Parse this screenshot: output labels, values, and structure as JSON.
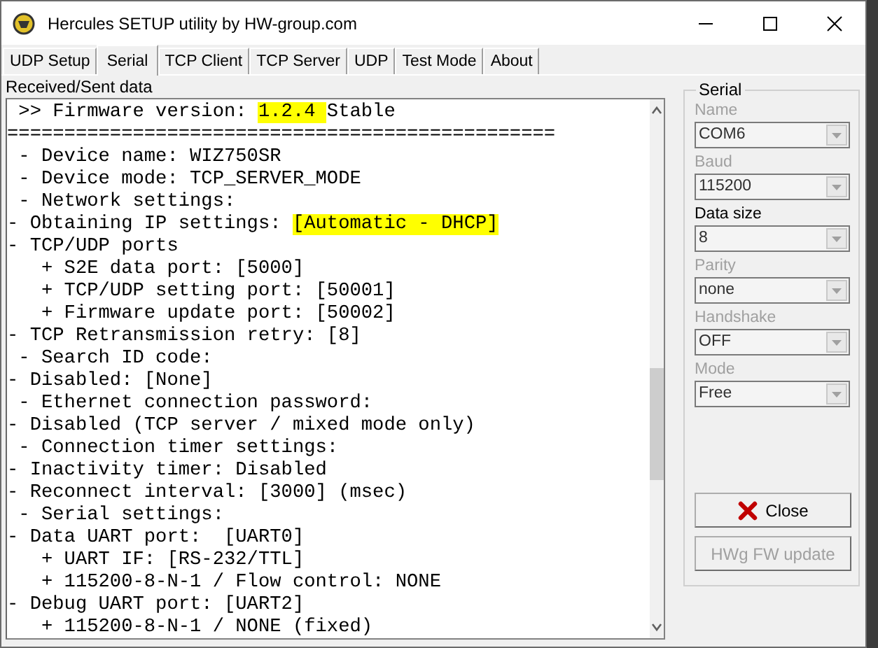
{
  "window": {
    "title": "Hercules SETUP utility by HW-group.com"
  },
  "tabs": [
    {
      "label": "UDP Setup",
      "selected": false
    },
    {
      "label": "Serial",
      "selected": true
    },
    {
      "label": "TCP Client",
      "selected": false
    },
    {
      "label": "TCP Server",
      "selected": false
    },
    {
      "label": "UDP",
      "selected": false
    },
    {
      "label": "Test Mode",
      "selected": false
    },
    {
      "label": "About",
      "selected": false
    }
  ],
  "data_section": {
    "label": "Received/Sent data",
    "lines": [
      {
        "parts": [
          {
            "text": " >> Firmware version: ",
            "highlighted": false
          },
          {
            "text": "1.2.4 ",
            "highlighted": true
          },
          {
            "text": "Stable",
            "highlighted": false
          }
        ]
      },
      {
        "parts": [
          {
            "text": "================================================",
            "highlighted": false
          }
        ]
      },
      {
        "parts": [
          {
            "text": " - Device name: WIZ750SR",
            "highlighted": false
          }
        ]
      },
      {
        "parts": [
          {
            "text": " - Device mode: TCP_SERVER_MODE",
            "highlighted": false
          }
        ]
      },
      {
        "parts": [
          {
            "text": " - Network settings:",
            "highlighted": false
          }
        ]
      },
      {
        "parts": [
          {
            "text": "- Obtaining IP settings: ",
            "highlighted": false
          },
          {
            "text": "[Automatic - DHCP]",
            "highlighted": true
          }
        ]
      },
      {
        "parts": [
          {
            "text": "- TCP/UDP ports",
            "highlighted": false
          }
        ]
      },
      {
        "parts": [
          {
            "text": "   + S2E data port: [5000]",
            "highlighted": false
          }
        ]
      },
      {
        "parts": [
          {
            "text": "   + TCP/UDP setting port: [50001]",
            "highlighted": false
          }
        ]
      },
      {
        "parts": [
          {
            "text": "   + Firmware update port: [50002]",
            "highlighted": false
          }
        ]
      },
      {
        "parts": [
          {
            "text": "- TCP Retransmission retry: [8]",
            "highlighted": false
          }
        ]
      },
      {
        "parts": [
          {
            "text": " - Search ID code:",
            "highlighted": false
          }
        ]
      },
      {
        "parts": [
          {
            "text": "- Disabled: [None]",
            "highlighted": false
          }
        ]
      },
      {
        "parts": [
          {
            "text": " - Ethernet connection password:",
            "highlighted": false
          }
        ]
      },
      {
        "parts": [
          {
            "text": "- Disabled (TCP server / mixed mode only)",
            "highlighted": false
          }
        ]
      },
      {
        "parts": [
          {
            "text": " - Connection timer settings:",
            "highlighted": false
          }
        ]
      },
      {
        "parts": [
          {
            "text": "- Inactivity timer: Disabled",
            "highlighted": false
          }
        ]
      },
      {
        "parts": [
          {
            "text": "- Reconnect interval: [3000] (msec)",
            "highlighted": false
          }
        ]
      },
      {
        "parts": [
          {
            "text": " - Serial settings:",
            "highlighted": false
          }
        ]
      },
      {
        "parts": [
          {
            "text": "- Data UART port:  [UART0]",
            "highlighted": false
          }
        ]
      },
      {
        "parts": [
          {
            "text": "   + UART IF: [RS-232/TTL]",
            "highlighted": false
          }
        ]
      },
      {
        "parts": [
          {
            "text": "   + 115200-8-N-1 / Flow control: NONE",
            "highlighted": false
          }
        ]
      },
      {
        "parts": [
          {
            "text": "- Debug UART port: [UART2]",
            "highlighted": false
          }
        ]
      },
      {
        "parts": [
          {
            "text": "   + 115200-8-N-1 / NONE (fixed)",
            "highlighted": false
          }
        ]
      }
    ]
  },
  "serial_panel": {
    "title": "Serial",
    "fields": [
      {
        "label": "Name",
        "value": "COM6",
        "disabled": true
      },
      {
        "label": "Baud",
        "value": "115200",
        "disabled": true
      },
      {
        "label": "Data size",
        "value": "8",
        "disabled": false
      },
      {
        "label": "Parity",
        "value": "none",
        "disabled": true
      },
      {
        "label": "Handshake",
        "value": "OFF",
        "disabled": true
      },
      {
        "label": "Mode",
        "value": "Free",
        "disabled": true
      }
    ],
    "buttons": [
      {
        "label": "Close",
        "disabled": false,
        "kind": "close"
      },
      {
        "label": "HWg FW update",
        "disabled": true,
        "kind": "plain"
      }
    ]
  }
}
